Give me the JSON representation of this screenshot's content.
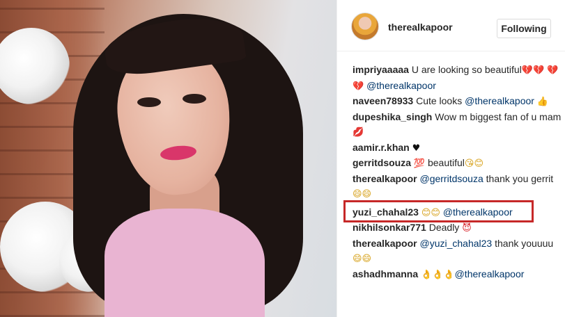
{
  "post": {
    "username": "therealkapoor",
    "follow_label": "Following"
  },
  "comments": [
    {
      "user": "impriyaaaaa",
      "text": "U are looking so beautiful",
      "emoji_a": "💔💔",
      "emoji_b": "💔💔",
      "mention": "@therealkapoor"
    },
    {
      "user": "naveen78933",
      "text": "Cute looks",
      "mention": "@therealkapoor",
      "emoji": "👍"
    },
    {
      "user": "dupeshika_singh",
      "text": "Wow m biggest fan of u mam",
      "emoji": "💋"
    },
    {
      "user": "aamir.r.khan",
      "emoji": "♥"
    },
    {
      "user": "gerritdsouza",
      "emoji_a": "💯",
      "text": "beautiful",
      "emoji_b": "😘😊"
    },
    {
      "user": "therealkapoor",
      "mention": "@gerritdsouza",
      "text": "thank you gerrit",
      "emoji": "😄😄"
    },
    {
      "user": "yuzi_chahal23",
      "emoji": "😊😊",
      "mention": "@therealkapoor"
    },
    {
      "user": "nikhilsonkar771",
      "text": "Deadly",
      "emoji": "😈"
    },
    {
      "user": "therealkapoor",
      "mention": "@yuzi_chahal23",
      "text": "thank youuuu",
      "emoji": "😄😄"
    },
    {
      "user": "ashadhmanna",
      "emoji": "👌👌👌",
      "mention": "@therealkapoor"
    }
  ],
  "colors": {
    "highlight_box": "#c62828",
    "mention": "#003569",
    "text": "#262626"
  }
}
